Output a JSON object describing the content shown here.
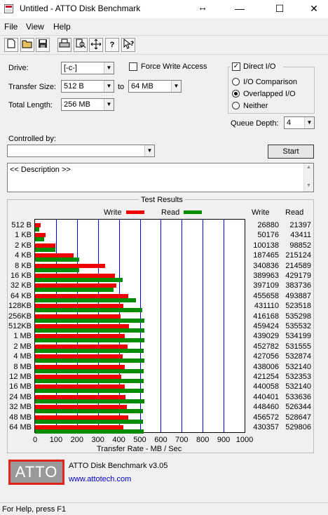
{
  "window": {
    "title": "Untitled - ATTO Disk Benchmark",
    "minimize_glyph": "—",
    "maximize_glyph": "☐",
    "close_glyph": "✕",
    "move_glyph": "↔"
  },
  "menu": [
    "File",
    "View",
    "Help"
  ],
  "toolbar_icons": [
    "new-file-icon",
    "open-folder-icon",
    "save-icon",
    "print-icon",
    "print-preview-icon",
    "move-icon",
    "help-icon",
    "context-help-icon"
  ],
  "form": {
    "drive_label": "Drive:",
    "drive_value": "[-c-]",
    "force_write_label": "Force Write Access",
    "force_write_checked": false,
    "transfer_size_label": "Transfer Size:",
    "transfer_from": "512 B",
    "to_label": "to",
    "transfer_to": "64 MB",
    "total_length_label": "Total Length:",
    "total_length": "256 MB",
    "direct_io_label": "Direct I/O",
    "direct_io_checked": true,
    "io_comparison_label": "I/O Comparison",
    "overlapped_io_label": "Overlapped I/O",
    "neither_label": "Neither",
    "selected_io_mode": "Overlapped I/O",
    "queue_depth_label": "Queue Depth:",
    "queue_depth": "4",
    "controlled_by_label": "Controlled by:",
    "controlled_by_value": "",
    "start_label": "Start",
    "description_text": "<< Description >>"
  },
  "results": {
    "title": "Test Results",
    "legend_write": "Write",
    "legend_read": "Read",
    "col_write": "Write",
    "col_read": "Read",
    "xlabel": "Transfer Rate - MB / Sec"
  },
  "chart_data": {
    "type": "bar",
    "title": "Test Results",
    "xlabel": "Transfer Rate - MB / Sec",
    "xlim": [
      0,
      1000
    ],
    "xticks": [
      0,
      100,
      200,
      300,
      400,
      500,
      600,
      700,
      800,
      900,
      1000
    ],
    "grid": true,
    "legend": "top",
    "colors": {
      "write": "#ee0000",
      "read": "#008c00",
      "grid": "#0000ff"
    },
    "categories": [
      "512 B",
      "1 KB",
      "2 KB",
      "4 KB",
      "8 KB",
      "16 KB",
      "32 KB",
      "64 KB",
      "128KB",
      "256KB",
      "512KB",
      "1 MB",
      "2 MB",
      "4 MB",
      "8 MB",
      "12 MB",
      "16 MB",
      "24 MB",
      "32 MB",
      "48 MB",
      "64 MB"
    ],
    "series": [
      {
        "name": "Write",
        "values": [
          26880,
          50176,
          100138,
          187465,
          340836,
          389963,
          397109,
          455658,
          431110,
          416168,
          459424,
          439029,
          452782,
          427056,
          438006,
          421254,
          440058,
          440401,
          448460,
          456572,
          430357
        ]
      },
      {
        "name": "Read",
        "values": [
          21397,
          43411,
          98852,
          215124,
          214589,
          429179,
          383736,
          493887,
          523518,
          535298,
          535532,
          534199,
          531555,
          532874,
          532140,
          532353,
          532140,
          533636,
          526344,
          528647,
          529806
        ]
      }
    ]
  },
  "footer": {
    "logo_text": "ATTO",
    "product": "ATTO Disk Benchmark v3.05",
    "url": "www.attotech.com"
  },
  "status": "For Help, press F1"
}
